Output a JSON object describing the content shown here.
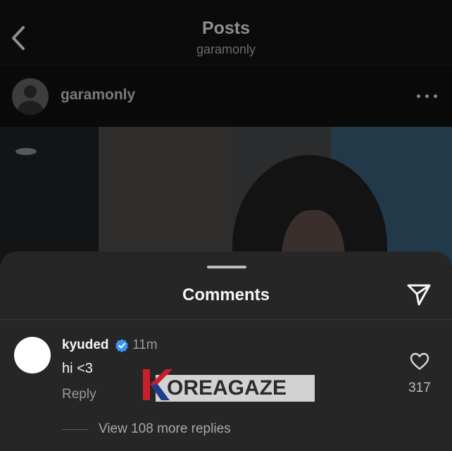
{
  "topbar": {
    "title": "Posts",
    "subtitle": "garamonly"
  },
  "post": {
    "username": "garamonly"
  },
  "comments_sheet": {
    "title": "Comments",
    "comment": {
      "username": "kyuded",
      "time": "11m",
      "text": "hi <3",
      "reply_label": "Reply",
      "likes": "317",
      "view_replies": "View 108 more replies"
    }
  },
  "watermark": {
    "text": "OREAGAZE"
  },
  "colors": {
    "verified": "#3797f0",
    "sheet_bg": "#262626",
    "watermark_k": "#c8202b",
    "watermark_blue": "#1f3b8c"
  },
  "icons": [
    "chevron-left",
    "more-dots",
    "send",
    "verified-badge",
    "heart"
  ]
}
